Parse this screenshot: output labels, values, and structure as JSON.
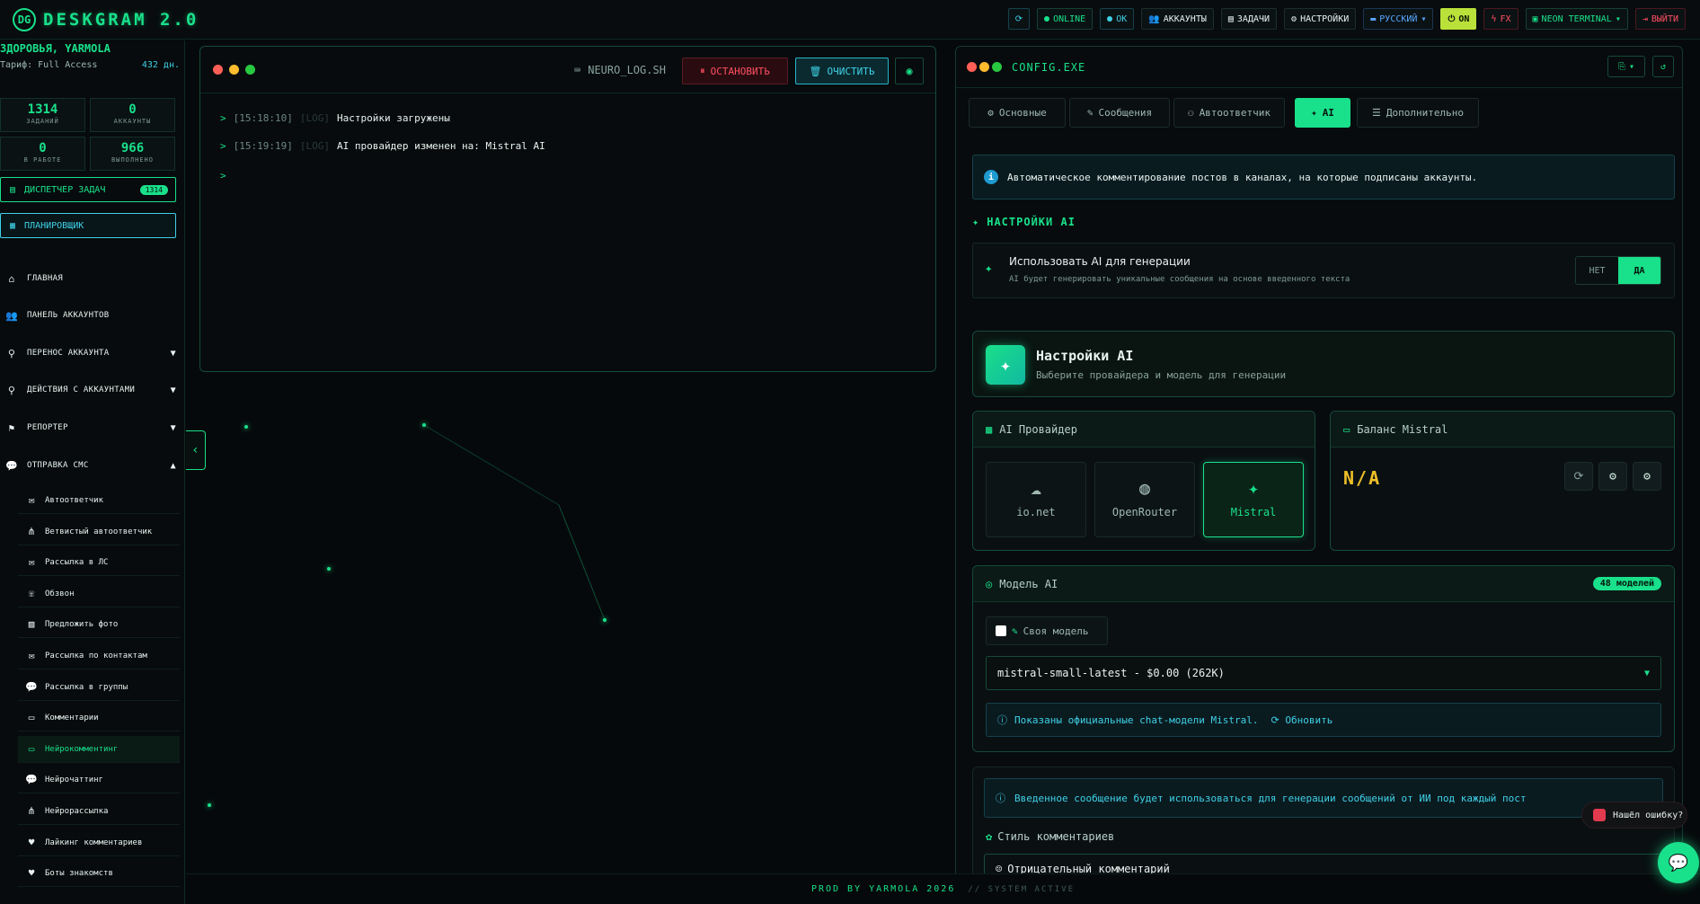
{
  "app": {
    "title": "DESKGRAM 2.0",
    "logo_mark": "DG"
  },
  "header": {
    "refresh_icon": "refresh-icon",
    "online": "ONLINE",
    "ok": "OK",
    "accounts": "АККАУНТЫ",
    "tasks": "ЗАДАЧИ",
    "settings": "НАСТРОЙКИ",
    "language": "РУССКИЙ",
    "on": "ON",
    "fx": "FX",
    "theme": "NEON TERMINAL",
    "logout": "ВЫЙТИ"
  },
  "sidebar": {
    "user_name": "ЗДОРОВЬЯ, YARMOLA",
    "tariff": "Тариф: Full Access",
    "days": "432 дн.",
    "stats": [
      {
        "value": "1314",
        "label": "ЗАДАНИЙ"
      },
      {
        "value": "0",
        "label": "АККАУНТЫ"
      },
      {
        "value": "0",
        "label": "В РАБОТЕ"
      },
      {
        "value": "966",
        "label": "ВЫПОЛНЕНО"
      }
    ],
    "dispatcher": {
      "label": "ДИСПЕТЧЕР ЗАДАЧ",
      "badge": "1314"
    },
    "scheduler": "ПЛАНИРОВЩИК",
    "nav": [
      {
        "label": "ГЛАВНАЯ",
        "icon": "home-icon"
      },
      {
        "label": "ПАНЕЛЬ АККАУНТОВ",
        "icon": "users-icon"
      },
      {
        "label": "ПЕРЕНОС АККАУНТА",
        "icon": "user-transfer-icon"
      },
      {
        "label": "ДЕЙСТВИЯ С АККАУНТАМИ",
        "icon": "user-action-icon"
      },
      {
        "label": "РЕПОРТЕР",
        "icon": "flag-icon"
      },
      {
        "label": "ОТПРАВКА СМС",
        "icon": "chat-icon"
      }
    ],
    "sub_items": [
      {
        "label": "Автоответчик",
        "icon": "mail-reply-icon"
      },
      {
        "label": "Ветвистый автоответчик",
        "icon": "tree-icon"
      },
      {
        "label": "Рассылка в ЛС",
        "icon": "envelope-icon"
      },
      {
        "label": "Обзвон",
        "icon": "phone-icon"
      },
      {
        "label": "Предложить фото",
        "icon": "image-icon"
      },
      {
        "label": "Рассылка по контактам",
        "icon": "contacts-mail-icon"
      },
      {
        "label": "Рассылка в группы",
        "icon": "group-chat-icon"
      },
      {
        "label": "Комментарии",
        "icon": "comment-icon"
      },
      {
        "label": "Нейрокомментинг",
        "icon": "ai-comment-icon"
      },
      {
        "label": "Нейрочаттинг",
        "icon": "ai-chat-icon"
      },
      {
        "label": "Нейрорассылка",
        "icon": "ai-mail-icon"
      },
      {
        "label": "Лайкинг комментариев",
        "icon": "heart-icon"
      },
      {
        "label": "Боты знакомств",
        "icon": "heart-icon"
      }
    ]
  },
  "terminal": {
    "file": "NEURO_LOG.SH",
    "stop": "ОСТАНОВИТЬ",
    "clear": "ОЧИСТИТЬ",
    "lines": [
      {
        "prompt": ">",
        "time": "[15:18:10]",
        "level": "[LOG]",
        "text": "Настройки загружены"
      },
      {
        "prompt": ">",
        "time": "[15:19:19]",
        "level": "[LOG]",
        "text": "AI провайдер изменен на: Mistral AI"
      }
    ],
    "cursor": ">"
  },
  "config": {
    "title": "CONFIG.EXE",
    "tabs": [
      {
        "label": "Основные",
        "icon": "gear-icon"
      },
      {
        "label": "Сообщения",
        "icon": "edit-icon"
      },
      {
        "label": "Автоответчик",
        "icon": "robot-icon"
      },
      {
        "label": "AI",
        "icon": "ai-icon"
      },
      {
        "label": "Дополнительно",
        "icon": "sliders-icon"
      }
    ],
    "info": "Автоматическое комментирование постов в каналах, на которые подписаны аккаунты.",
    "section_title": "НАСТРОЙКИ AI",
    "use_ai": {
      "title": "Использовать AI для генерации",
      "desc": "AI будет генерировать уникальные сообщения на основе введенного текста",
      "no": "НЕТ",
      "yes": "ДА"
    },
    "ai_card": {
      "title": "Настройки AI",
      "subtitle": "Выберите провайдера и модель для генерации"
    },
    "provider": {
      "title": "AI Провайдер",
      "options": [
        {
          "name": "io.net",
          "icon": "cloud-icon"
        },
        {
          "name": "OpenRouter",
          "icon": "globe-icon"
        },
        {
          "name": "Mistral",
          "icon": "sparkle-icon"
        }
      ],
      "selected": "Mistral"
    },
    "balance": {
      "title": "Баланс Mistral",
      "value": "N/A"
    },
    "model": {
      "title": "Модель AI",
      "count": "48 моделей",
      "own_model": "Своя модель",
      "selected": "mistral-small-latest - $0.00 (262K)",
      "note": "Показаны официальные chat-модели Mistral.",
      "refresh": "Обновить"
    },
    "prompt": {
      "note": "Введенное сообщение будет использоваться для генерации сообщений от ИИ под каждый пост",
      "style_label": "Стиль комментариев",
      "style_value": "Отрицательный комментарий"
    }
  },
  "footer": {
    "prod": "PROD BY YARMOLA 2026",
    "status": "// SYSTEM ACTIVE"
  },
  "report": "Нашёл ошибку?",
  "colors": {
    "accent": "#19e08a",
    "cyan": "#3fd1e6",
    "danger": "#ff4f62",
    "warning": "#f0c028",
    "bg": "#06090b"
  }
}
